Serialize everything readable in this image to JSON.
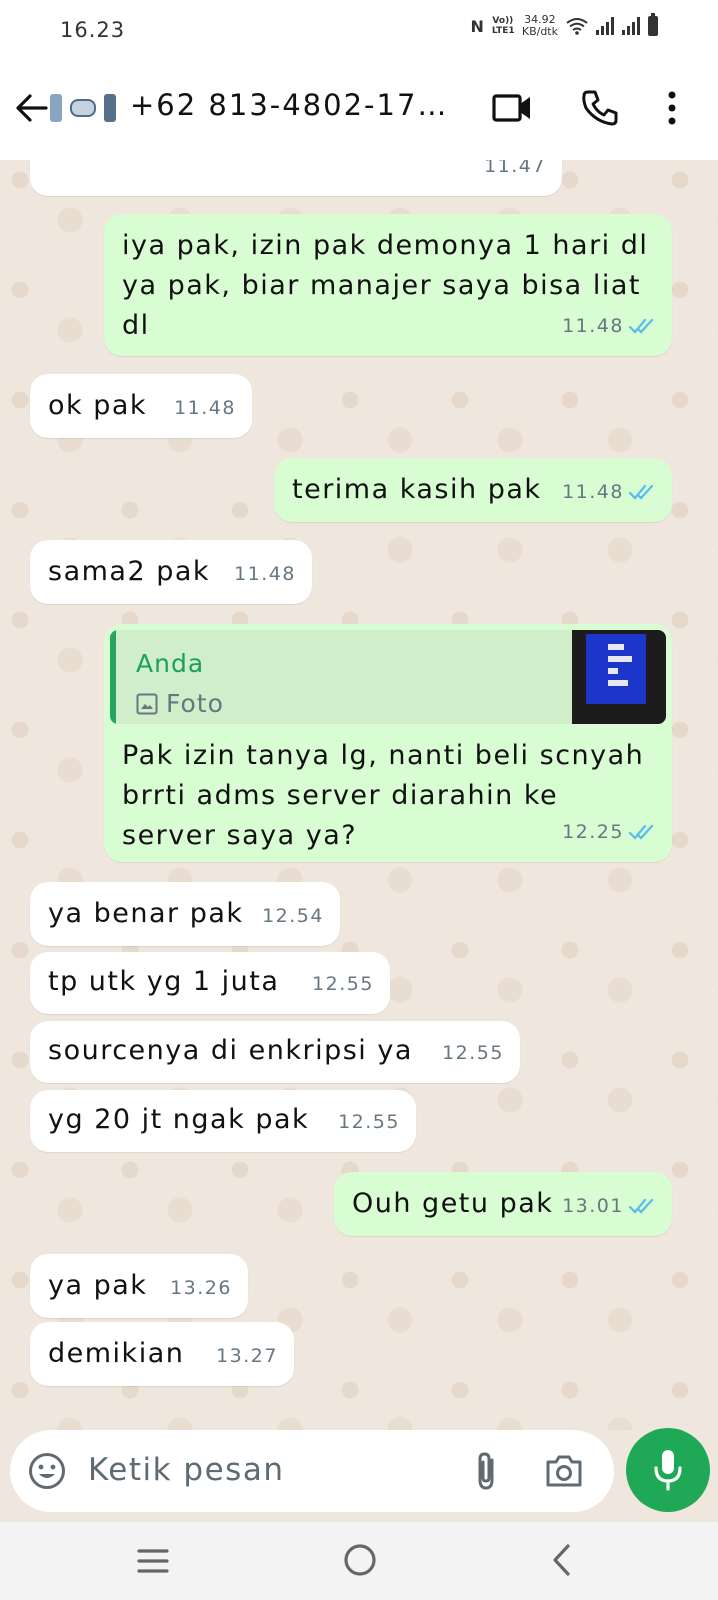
{
  "status_bar": {
    "time": "16.23",
    "network": "Vo)) LTE1",
    "speed_value": "34.92",
    "speed_unit": "KB/dtk"
  },
  "header": {
    "contact_name": "+62 813-4802-17…",
    "icons": [
      "back-arrow-icon",
      "video-call-icon",
      "phone-call-icon",
      "more-options-icon"
    ]
  },
  "messages": [
    {
      "direction": "incoming",
      "text": "",
      "time": "11.47"
    },
    {
      "direction": "outgoing",
      "text": "iya pak, izin pak demonya 1 hari dl\nya pak, biar manajer saya bisa liat\ndl",
      "time": "11.48",
      "read": true
    },
    {
      "direction": "incoming",
      "text": "ok pak",
      "time": "11.48"
    },
    {
      "direction": "outgoing",
      "text": "terima kasih pak",
      "time": "11.48",
      "read": true
    },
    {
      "direction": "incoming",
      "text": "sama2 pak",
      "time": "11.48"
    },
    {
      "direction": "outgoing",
      "quote": {
        "author": "Anda",
        "type": "Foto"
      },
      "text": "Pak izin tanya lg, nanti beli scnyah\nbrrti adms server diarahin ke\nserver saya ya?",
      "time": "12.25",
      "read": true
    },
    {
      "direction": "incoming",
      "text": "ya benar pak",
      "time": "12.54"
    },
    {
      "direction": "incoming",
      "text": "tp utk yg 1 juta",
      "time": "12.55"
    },
    {
      "direction": "incoming",
      "text": "sourcenya di enkripsi ya",
      "time": "12.55"
    },
    {
      "direction": "incoming",
      "text": "yg 20 jt ngak pak",
      "time": "12.55"
    },
    {
      "direction": "outgoing",
      "text": "Ouh getu pak",
      "time": "13.01",
      "read": true
    },
    {
      "direction": "incoming",
      "text": "ya pak",
      "time": "13.26"
    },
    {
      "direction": "incoming",
      "text": "demikian",
      "time": "13.27"
    }
  ],
  "input": {
    "placeholder": "Ketik pesan"
  },
  "colors": {
    "outgoing_bubble": "#d9fdd3",
    "incoming_bubble": "#ffffff",
    "accent_green": "#1fa855",
    "read_tick": "#53bdeb"
  }
}
